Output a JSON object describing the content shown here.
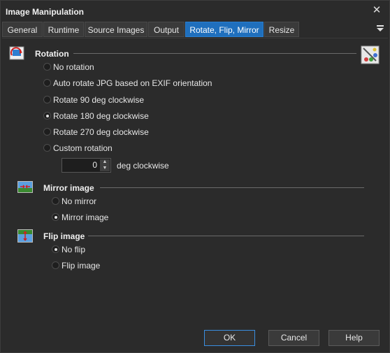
{
  "window": {
    "title": "Image Manipulation",
    "close_glyph": "✕"
  },
  "tabs": [
    {
      "label": "General",
      "active": false
    },
    {
      "label": "Runtime",
      "active": false
    },
    {
      "label": "Source Images",
      "active": false
    },
    {
      "label": "Output",
      "active": false
    },
    {
      "label": "Rotate, Flip, Mirror",
      "active": true
    },
    {
      "label": "Resize",
      "active": false
    }
  ],
  "tab_menu_icon": "dropdown-menu-icon",
  "rotation": {
    "title": "Rotation",
    "icon": "rotate-icon",
    "options": [
      {
        "label": "No rotation",
        "checked": false
      },
      {
        "label": "Auto rotate JPG based on EXIF orientation",
        "checked": false
      },
      {
        "label": "Rotate 90 deg clockwise",
        "checked": false
      },
      {
        "label": "Rotate 180 deg clockwise",
        "checked": true
      },
      {
        "label": "Rotate 270 deg clockwise",
        "checked": false
      },
      {
        "label": "Custom rotation",
        "checked": false
      }
    ],
    "custom_value": "0",
    "custom_unit": "deg clockwise"
  },
  "mirror": {
    "title": "Mirror image",
    "icon": "mirror-image-icon",
    "options": [
      {
        "label": "No mirror",
        "checked": false
      },
      {
        "label": "Mirror image",
        "checked": true
      }
    ]
  },
  "flip": {
    "title": "Flip image",
    "icon": "flip-image-icon",
    "options": [
      {
        "label": "No flip",
        "checked": true
      },
      {
        "label": "Flip image",
        "checked": false
      }
    ]
  },
  "buttons": {
    "ok": "OK",
    "cancel": "Cancel",
    "help": "Help"
  },
  "colors": {
    "accent": "#1f6fbd",
    "background": "#2b2b2b",
    "text": "#e8e8e8"
  }
}
